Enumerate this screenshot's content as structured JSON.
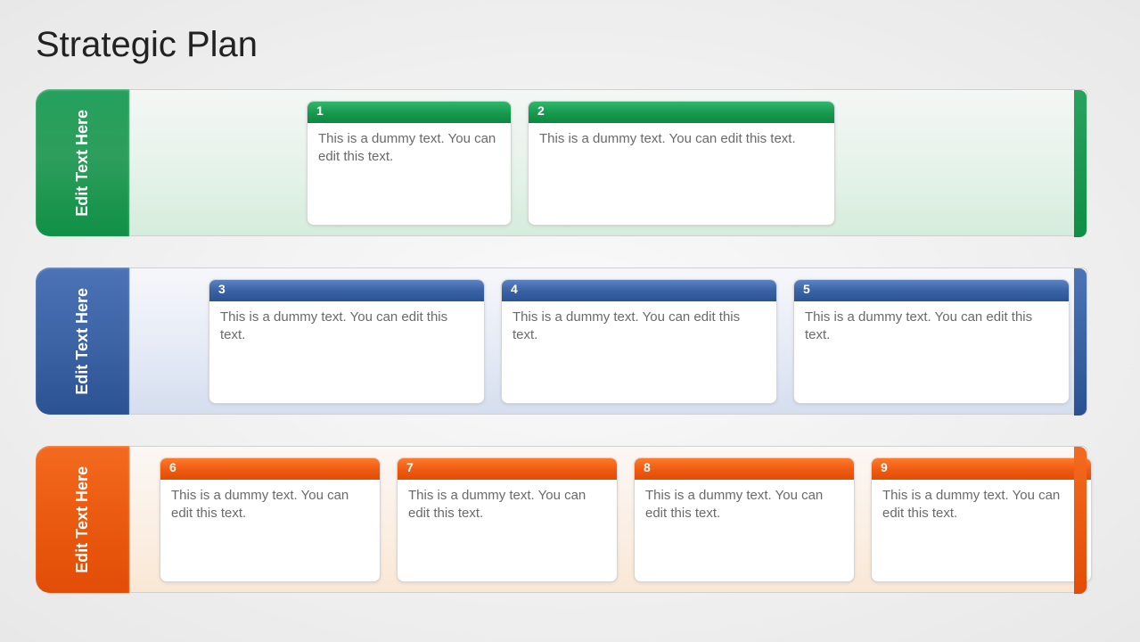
{
  "title": "Strategic Plan",
  "rows": [
    {
      "tab": "Edit Text Here",
      "cards": [
        {
          "num": "1",
          "body": "This is a dummy text. You can edit this text."
        },
        {
          "num": "2",
          "body": "This is a dummy text. You can edit this text."
        }
      ]
    },
    {
      "tab": "Edit Text Here",
      "cards": [
        {
          "num": "3",
          "body": "This is a dummy text. You can edit this text."
        },
        {
          "num": "4",
          "body": "This is a dummy text. You can edit this text."
        },
        {
          "num": "5",
          "body": "This is a dummy text. You can edit this text."
        }
      ]
    },
    {
      "tab": "Edit Text Here",
      "cards": [
        {
          "num": "6",
          "body": "This is a dummy text. You can edit this text."
        },
        {
          "num": "7",
          "body": "This is a dummy text. You can edit this text."
        },
        {
          "num": "8",
          "body": "This is a dummy text. You can edit this text."
        },
        {
          "num": "9",
          "body": "This is a dummy text. You can edit this text."
        }
      ]
    }
  ]
}
